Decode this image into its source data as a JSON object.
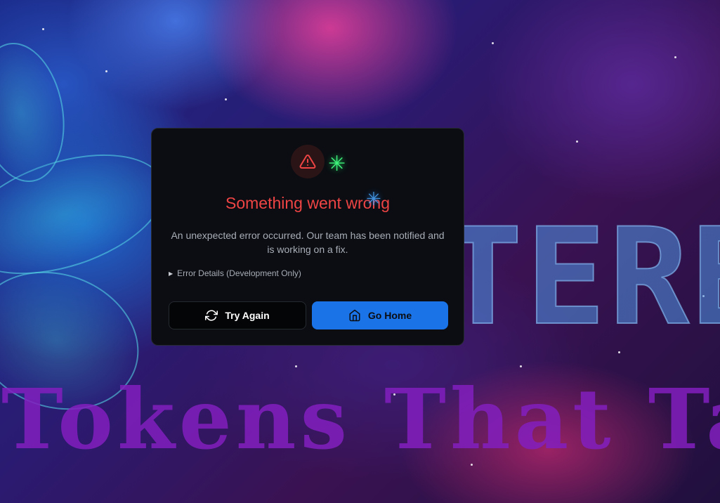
{
  "background": {
    "brand_fragment": "TERBY",
    "tagline": "Tokens That Talk"
  },
  "dialog": {
    "icon": "alert-triangle-icon",
    "title": "Something went wrong",
    "description": "An unexpected error occurred. Our team has been notified and is working on a fix.",
    "details_label": "Error Details (Development Only)",
    "details_expanded": false,
    "try_again_label": "Try Again",
    "try_again_icon": "refresh-icon",
    "go_home_label": "Go Home",
    "go_home_icon": "home-icon"
  },
  "colors": {
    "error": "#ef4444",
    "primary": "#1a74e8",
    "dialog_bg": "#0b0d12"
  }
}
